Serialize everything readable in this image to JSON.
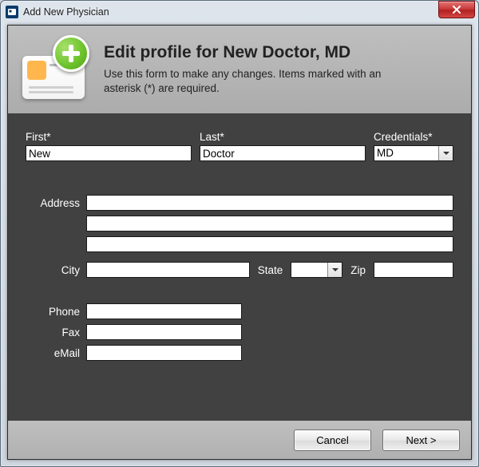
{
  "window": {
    "title": "Add New Physician"
  },
  "header": {
    "title": "Edit profile for New Doctor, MD",
    "subtitle": "Use this form to make any changes.  Items marked with an asterisk (*) are required."
  },
  "labels": {
    "first": "First*",
    "last": "Last*",
    "credentials": "Credentials*",
    "address": "Address",
    "city": "City",
    "state": "State",
    "zip": "Zip",
    "phone": "Phone",
    "fax": "Fax",
    "email": "eMail"
  },
  "values": {
    "first": "New",
    "last": "Doctor",
    "credentials": "MD",
    "address1": "",
    "address2": "",
    "address3": "",
    "city": "",
    "state": "",
    "zip": "",
    "phone": "",
    "fax": "",
    "email": ""
  },
  "buttons": {
    "cancel": "Cancel",
    "next": "Next >"
  }
}
